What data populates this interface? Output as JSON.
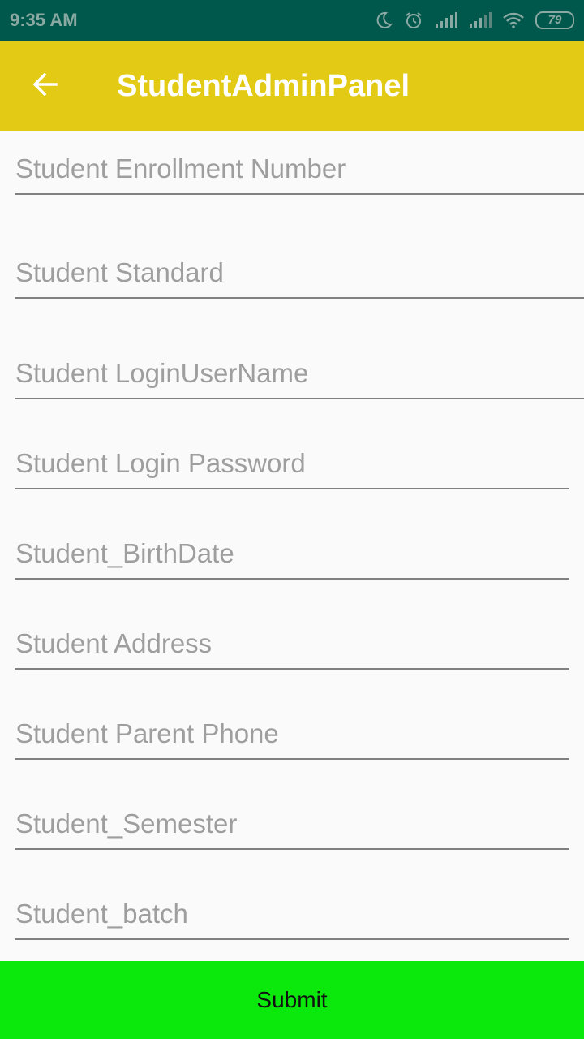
{
  "status_bar": {
    "time": "9:35 AM",
    "battery": "79",
    "icons": [
      "moon-icon",
      "alarm-icon",
      "signal-icon",
      "signal-icon",
      "wifi-icon",
      "battery-icon"
    ]
  },
  "app_bar": {
    "title": "StudentAdminPanel",
    "back_icon": "arrow-left-icon",
    "color": "#e2ca15"
  },
  "form": {
    "fields": [
      {
        "placeholder": "Student Enrollment Number",
        "value": ""
      },
      {
        "placeholder": "Student Standard",
        "value": ""
      },
      {
        "placeholder": "Student LoginUserName",
        "value": ""
      },
      {
        "placeholder": "Student Login Password",
        "value": ""
      },
      {
        "placeholder": "Student_BirthDate",
        "value": ""
      },
      {
        "placeholder": "Student Address",
        "value": ""
      },
      {
        "placeholder": "Student Parent Phone",
        "value": ""
      },
      {
        "placeholder": "Student_Semester",
        "value": ""
      },
      {
        "placeholder": "Student_batch",
        "value": ""
      }
    ]
  },
  "submit": {
    "label": "Submit",
    "color": "#0be80b"
  }
}
